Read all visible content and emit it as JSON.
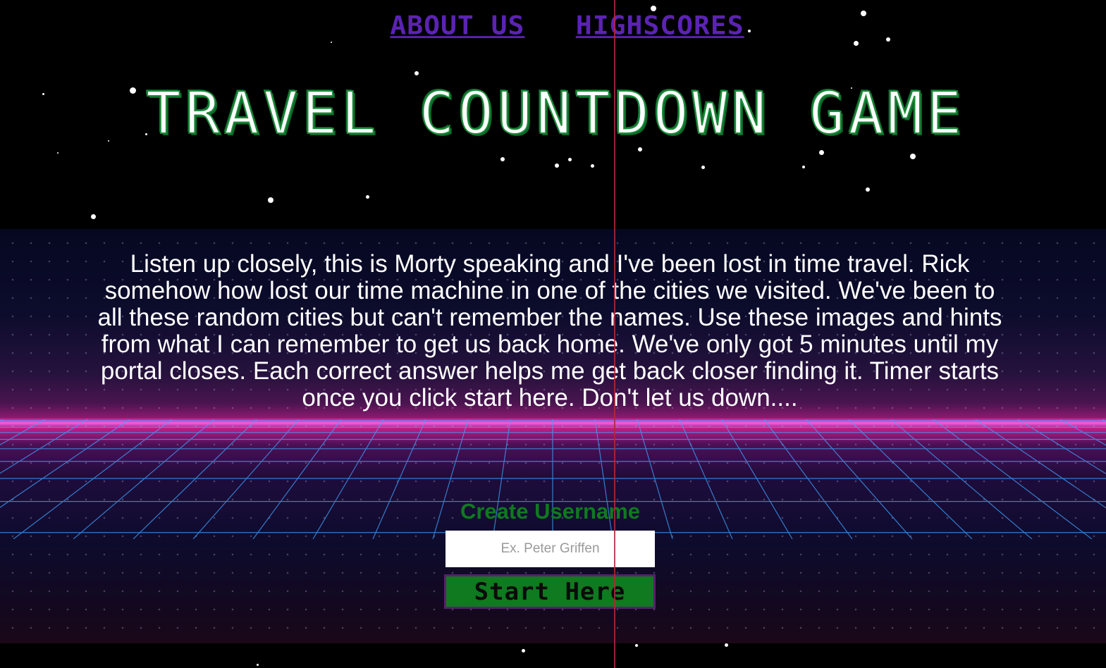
{
  "nav": {
    "about_label": "ABOUT US",
    "highscores_label": "HIGHSCORES"
  },
  "title": "TRAVEL COUNTDOWN GAME",
  "story": "Listen up closely, this is Morty speaking and I've been lost in time travel. Rick somehow how lost our time machine in one of the cities we visited. We've been to all these random cities but can't remember the names. Use these images and hints from what I can remember to get us back home. We've only got 5 minutes until my portal closes. Each correct answer helps me get back closer finding it. Timer starts once you click start here. Don't let us down....",
  "form": {
    "username_label": "Create Username",
    "username_placeholder": "Ex. Peter Griffen",
    "username_value": "",
    "start_label": "Start Here"
  },
  "colors": {
    "nav_link": "#5b23b4",
    "title_outline": "#1d8a3a",
    "label_green": "#0f7a1f",
    "button_bg": "#0f7a1f",
    "button_border": "#5a1f6e",
    "horizon_pink": "#ff2fc9",
    "grid_blue": "#3fa3ff"
  }
}
